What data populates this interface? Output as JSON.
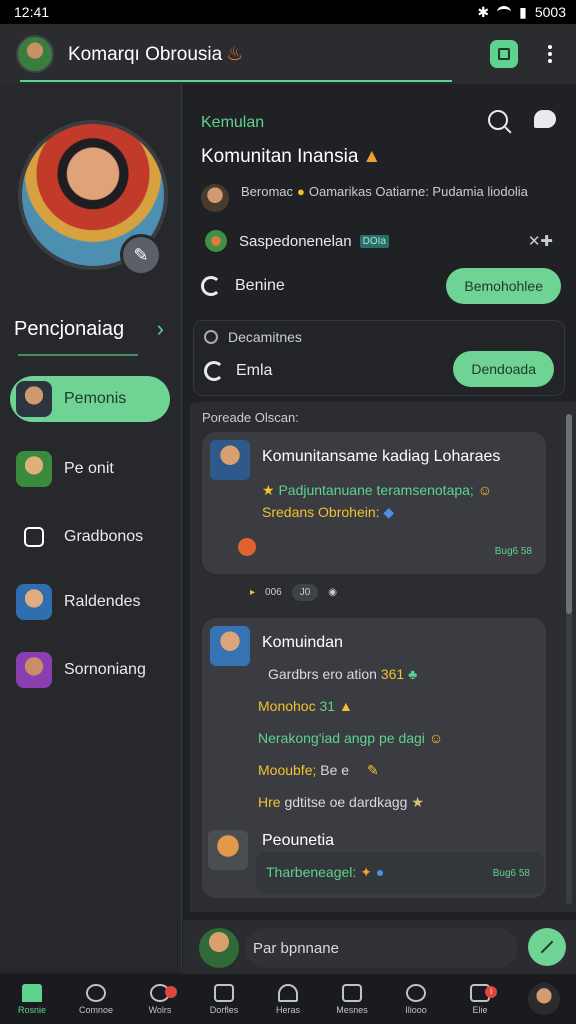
{
  "status": {
    "time": "12:41",
    "battery": "5003"
  },
  "topbar": {
    "title": "Komarqı Obrousia"
  },
  "sidebar": {
    "section_title": "Pencjonaiag",
    "items": [
      {
        "label": "Pemonis",
        "active": true,
        "color": "#6fd393"
      },
      {
        "label": "Pe onit",
        "active": false
      },
      {
        "label": "Gradbonos",
        "active": false
      },
      {
        "label": "Raldendes",
        "active": false
      },
      {
        "label": "Sornoniang",
        "active": false
      }
    ]
  },
  "community": {
    "tag": "Kemulan",
    "title": "Komunitan Inansia",
    "row1": {
      "name": "Beromac",
      "text": "Oamarikas Oatiarne: Pudamia liodolia"
    },
    "row2": {
      "text": "Saspedonenelan",
      "badge": "DOIa"
    },
    "row3": {
      "label": "Benine",
      "button": "Bemohohlee"
    },
    "card2": {
      "label": "Decamitnes",
      "sublabel": "Emla",
      "button": "Dendoada"
    }
  },
  "feed": {
    "label": "Poreade Olscan:",
    "posts": [
      {
        "title": "Komunitansame kadiag Loharaes",
        "line1": "Padjuntanuane teramsenotapa;",
        "line2": "Sredans Obrohein:",
        "time": "Bug6 58",
        "reactions": [
          "006",
          "J0"
        ]
      },
      {
        "title": "Komuindan",
        "lines": [
          {
            "text": "Gardbrs ero ation",
            "emph": "361",
            "color": "#d8dadd",
            "emph_color": "#f2c230"
          },
          {
            "text": "Monohoc",
            "emph": "31",
            "color": "#f2c230",
            "emph_color": "#5fd38d"
          },
          {
            "text": "Nerakong'iad angp pe dagi",
            "emph": "",
            "color": "#5fd38d",
            "emph_color": "#5fd38d"
          },
          {
            "text": "Mooubfe;",
            "emph": "Be e",
            "color": "#f2c230",
            "emph_color": "#d8dadd"
          },
          {
            "text": "Hre",
            "emph": "gdtitse oe dardkagg",
            "color": "#f2c230",
            "emph_color": "#d8dadd"
          }
        ],
        "reply_name": "Peounetia",
        "reply_text": "Tharbeneagel:",
        "reply_time": "Bug6 58"
      }
    ]
  },
  "compose": {
    "placeholder": "Par bpnnane"
  },
  "bottomnav": {
    "items": [
      {
        "label": "Rosnie",
        "active": true
      },
      {
        "label": "Comnoe"
      },
      {
        "label": "Wolrs",
        "badge": ""
      },
      {
        "label": "Dorfles"
      },
      {
        "label": "Heras"
      },
      {
        "label": "Mesnes"
      },
      {
        "label": "Iliooo"
      },
      {
        "label": "Elie",
        "badge": "i"
      }
    ]
  }
}
